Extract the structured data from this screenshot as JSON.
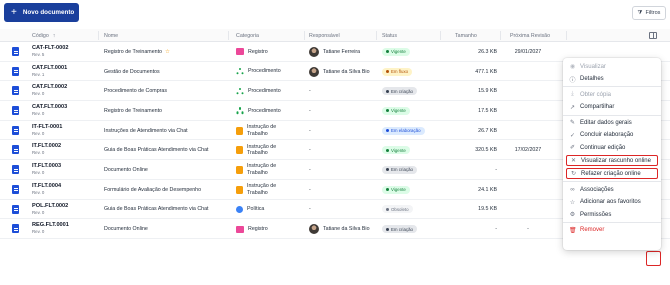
{
  "toolbar": {
    "new_label": "Novo documento",
    "filter_label": "Filtros"
  },
  "columns": {
    "codigo": "Código",
    "nome": "Nome",
    "categoria": "Categoria",
    "responsavel": "Responsável",
    "status": "Status",
    "tamanho": "Tamanho",
    "proxima_revisao": "Próxima Revisão"
  },
  "rows": [
    {
      "code": "CAT-FLT-0002",
      "rev": "Rev. 5",
      "name": "Registro de Treinamento",
      "star": "☆",
      "cat": "Registro",
      "cat_icon": "folder",
      "resp": "Tatiane Ferreira",
      "avatar": true,
      "status": "Vigente",
      "status_kind": "vig",
      "size": "26.3 KB",
      "next": "29/01/2027"
    },
    {
      "code": "CAT.FLT.0001",
      "rev": "Rev. 1",
      "name": "Gestão de Documentos",
      "star": "",
      "cat": "Procedimento",
      "cat_icon": "proc",
      "resp": "Tatiane da Silva Bio",
      "avatar": true,
      "status": "Em fluxo",
      "status_kind": "flu",
      "size": "477.1 KB",
      "next": ""
    },
    {
      "code": "CAT.FLT.0002",
      "rev": "Rev. 0",
      "name": "Procedimento de Compras",
      "star": "",
      "cat": "Procedimento",
      "cat_icon": "proc",
      "resp": "-",
      "avatar": false,
      "status": "Em criação",
      "status_kind": "cri",
      "size": "15.9 KB",
      "next": ""
    },
    {
      "code": "CAT.FLT.0003",
      "rev": "Rev. 0",
      "name": "Registro de Treinamento",
      "star": "",
      "cat": "Procedimento",
      "cat_icon": "proc",
      "resp": "-",
      "avatar": false,
      "status": "Vigente",
      "status_kind": "vig",
      "size": "17.5 KB",
      "next": ""
    },
    {
      "code": "IT-FLT-0001",
      "rev": "Rev. 0",
      "name": "Instruções de Atendimento via Chat",
      "star": "",
      "cat": "Instrução de Trabalho",
      "cat_icon": "instr",
      "resp": "-",
      "avatar": false,
      "status": "Em elaboração",
      "status_kind": "ela",
      "size": "26.7 KB",
      "next": ""
    },
    {
      "code": "IT.FLT.0002",
      "rev": "Rev. 0",
      "name": "Guia de Boas Práticas Atendimento via Chat",
      "star": "",
      "cat": "Instrução de Trabalho",
      "cat_icon": "instr",
      "resp": "-",
      "avatar": false,
      "status": "Vigente",
      "status_kind": "vig",
      "size": "320.5 KB",
      "next": "17/02/2027"
    },
    {
      "code": "IT.FLT.0003",
      "rev": "Rev. 0",
      "name": "Documento Online",
      "star": "",
      "cat": "Instrução de Trabalho",
      "cat_icon": "instr",
      "resp": "-",
      "avatar": false,
      "status": "Em criação",
      "status_kind": "cri",
      "size": "-",
      "next": ""
    },
    {
      "code": "IT.FLT.0004",
      "rev": "Rev. 0",
      "name": "Formulário de Avaliação de Desempenho",
      "star": "",
      "cat": "Instrução de Trabalho",
      "cat_icon": "instr",
      "resp": "-",
      "avatar": false,
      "status": "Vigente",
      "status_kind": "vig",
      "size": "24.1 KB",
      "next": ""
    },
    {
      "code": "POL.FLT.0002",
      "rev": "Rev. 0",
      "name": "Guia de Boas Práticas Atendimento via Chat",
      "star": "",
      "cat": "Política",
      "cat_icon": "pol",
      "resp": "-",
      "avatar": false,
      "status": "Obsoleto",
      "status_kind": "obs",
      "size": "19.5 KB",
      "next": ""
    },
    {
      "code": "REG.FLT.0001",
      "rev": "Rev. 0",
      "name": "Documento Online",
      "star": "",
      "cat": "Registro",
      "cat_icon": "folder",
      "resp": "Tatiane da Silva Bio",
      "avatar": true,
      "status": "Em criação",
      "status_kind": "cri",
      "size": "-",
      "next": "-"
    }
  ],
  "menu": {
    "items": [
      {
        "label": "Visualizar",
        "icon": "eye-icon",
        "glyph": "◉",
        "state": "disabled"
      },
      {
        "label": "Detalhes",
        "icon": "info-icon",
        "glyph": "ⓘ",
        "state": "normal"
      },
      {
        "label": "Obter cópia",
        "icon": "download-icon",
        "glyph": "⤓",
        "state": "disabled"
      },
      {
        "label": "Compartilhar",
        "icon": "share-icon",
        "glyph": "↗",
        "state": "normal"
      },
      {
        "label": "Editar dados gerais",
        "icon": "edit-icon",
        "glyph": "✎",
        "state": "normal"
      },
      {
        "label": "Concluir elaboração",
        "icon": "check-circle-icon",
        "glyph": "✓",
        "state": "normal"
      },
      {
        "label": "Continuar edição",
        "icon": "pencil-icon",
        "glyph": "✐",
        "state": "normal"
      },
      {
        "label": "Visualizar rascunho online",
        "icon": "draft-view-icon",
        "glyph": "✕",
        "state": "highlight"
      },
      {
        "label": "Refazer criação online",
        "icon": "redo-icon",
        "glyph": "↻",
        "state": "highlight"
      },
      {
        "label": "Associações",
        "icon": "link-icon",
        "glyph": "∞",
        "state": "normal"
      },
      {
        "label": "Adicionar aos favoritos",
        "icon": "star-icon",
        "glyph": "☆",
        "state": "normal"
      },
      {
        "label": "Permissões",
        "icon": "permissions-icon",
        "glyph": "⚙",
        "state": "normal"
      },
      {
        "label": "Remover",
        "icon": "trash-icon",
        "glyph": "🗑",
        "state": "danger"
      }
    ]
  },
  "colors": {
    "primary": "#1a3f9c",
    "danger": "#dc2626"
  }
}
